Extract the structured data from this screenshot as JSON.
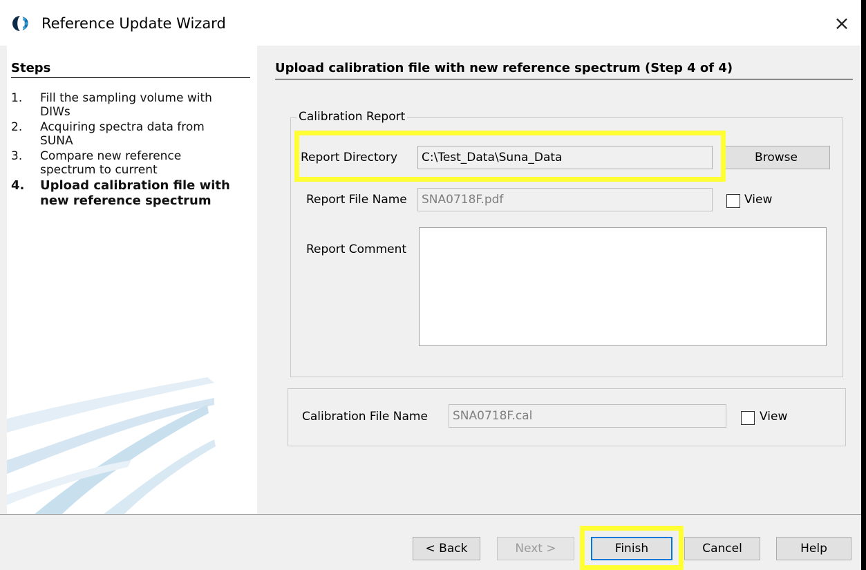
{
  "window": {
    "title": "Reference Update Wizard",
    "app_icon": "wizard-app-icon",
    "close_icon": "close-icon",
    "close_glyph": "×"
  },
  "steps": {
    "title": "Steps",
    "items": [
      {
        "num": "1.",
        "label": "Fill the sampling volume with DIWs"
      },
      {
        "num": "2.",
        "label": "Acquiring spectra data from SUNA"
      },
      {
        "num": "3.",
        "label": "Compare new reference spectrum to current"
      },
      {
        "num": "4.",
        "label": "Upload calibration file with new reference spectrum"
      }
    ]
  },
  "page": {
    "heading": "Upload calibration file with new reference spectrum (Step 4 of 4)"
  },
  "calibration_report": {
    "legend": "Calibration Report",
    "report_directory_label": "Report Directory",
    "report_directory_value": "C:\\Test_Data\\Suna_Data",
    "browse_label": "Browse",
    "report_file_name_label": "Report File Name",
    "report_file_name_value": "SNA0718F.pdf",
    "view_label": "View",
    "report_comment_label": "Report Comment",
    "report_comment_value": ""
  },
  "calibration_file": {
    "label": "Calibration File Name",
    "value": "SNA0718F.cal",
    "view_label": "View"
  },
  "footer": {
    "back_label": "< Back",
    "next_label": "Next >",
    "finish_label": "Finish",
    "cancel_label": "Cancel",
    "help_label": "Help"
  },
  "colors": {
    "highlight": "#ffff33",
    "accent": "#0078d7"
  }
}
